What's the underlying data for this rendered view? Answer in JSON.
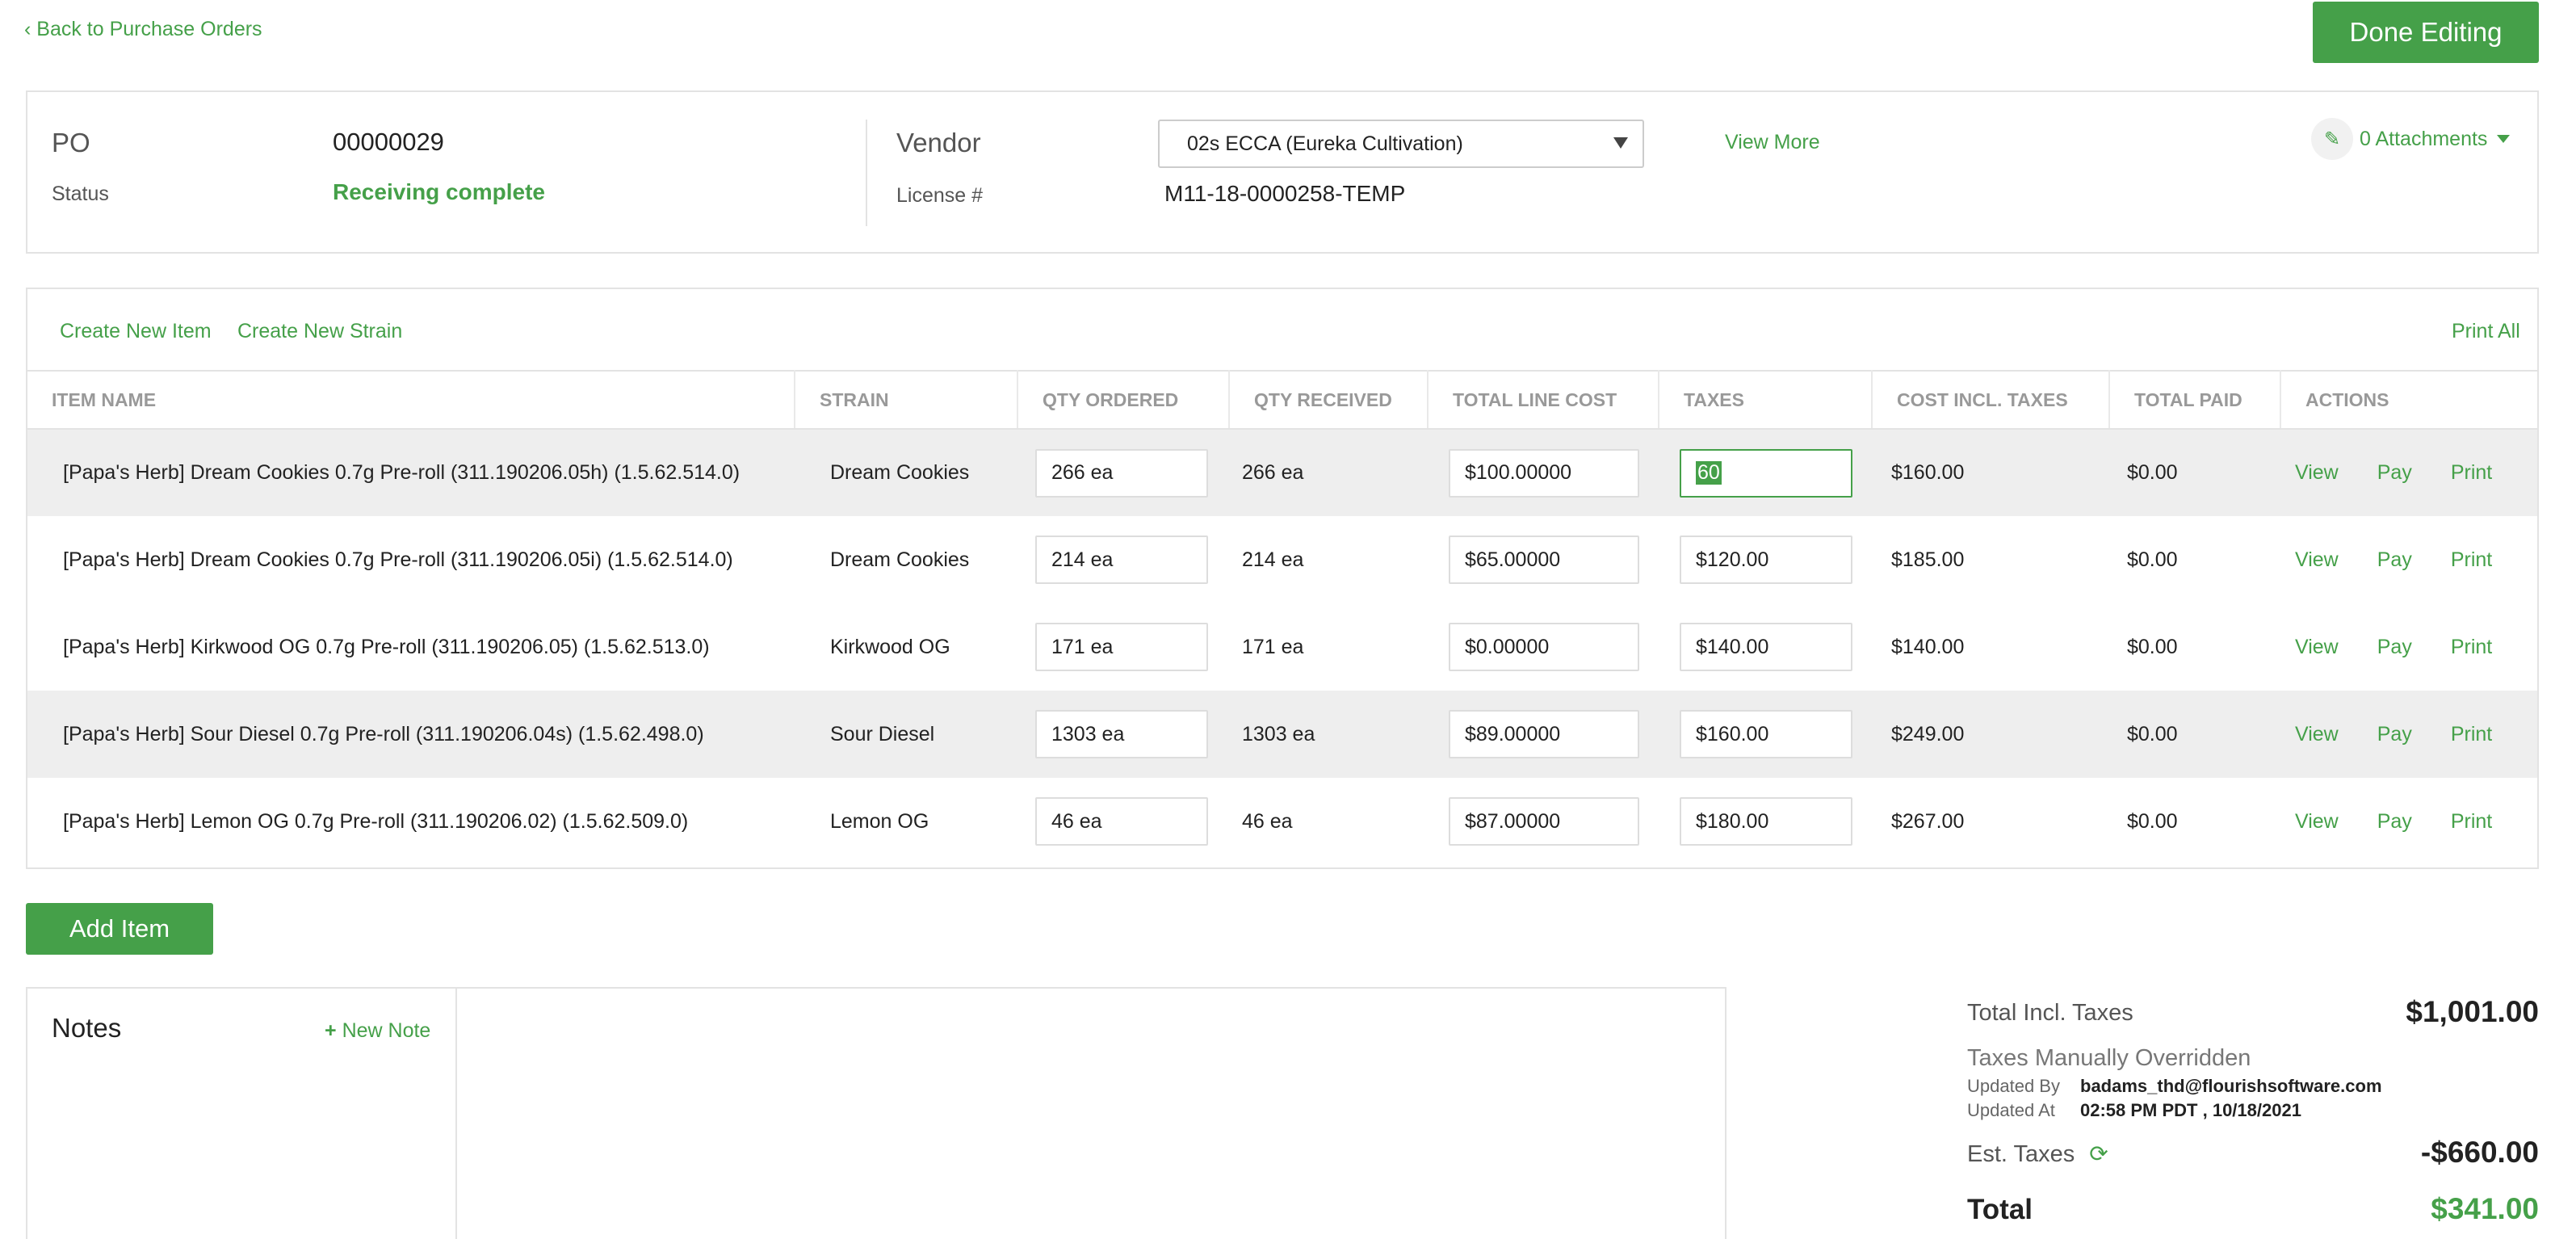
{
  "nav": {
    "back_label": "‹ Back to Purchase Orders",
    "done_label": "Done Editing"
  },
  "po": {
    "po_label": "PO",
    "po_number": "00000029",
    "status_label": "Status",
    "status_value": "Receiving complete",
    "vendor_label": "Vendor",
    "vendor_value": "02s ECCA (Eureka Cultivation)",
    "license_label": "License #",
    "license_value": "M11-18-0000258-TEMP",
    "view_more": "View More",
    "attachments": "0 Attachments"
  },
  "toolbar": {
    "create_item": "Create New Item",
    "create_strain": "Create New Strain",
    "print_all": "Print All"
  },
  "table": {
    "headers": [
      "ITEM NAME",
      "STRAIN",
      "QTY ORDERED",
      "QTY RECEIVED",
      "TOTAL LINE COST",
      "TAXES",
      "COST INCL. TAXES",
      "TOTAL PAID",
      "ACTIONS"
    ],
    "rows": [
      {
        "item": "[Papa's Herb] Dream Cookies 0.7g Pre-roll (311.190206.05h) (1.5.62.514.0)",
        "strain": "Dream Cookies",
        "qty_ordered": "266 ea",
        "qty_received": "266 ea",
        "line_cost": "$100.00000",
        "taxes": "60",
        "cost_incl": "$160.00",
        "paid": "$0.00"
      },
      {
        "item": "[Papa's Herb] Dream Cookies 0.7g Pre-roll (311.190206.05i) (1.5.62.514.0)",
        "strain": "Dream Cookies",
        "qty_ordered": "214 ea",
        "qty_received": "214 ea",
        "line_cost": "$65.00000",
        "taxes": "$120.00",
        "cost_incl": "$185.00",
        "paid": "$0.00"
      },
      {
        "item": "[Papa's Herb] Kirkwood OG 0.7g Pre-roll (311.190206.05) (1.5.62.513.0)",
        "strain": "Kirkwood OG",
        "qty_ordered": "171 ea",
        "qty_received": "171 ea",
        "line_cost": "$0.00000",
        "taxes": "$140.00",
        "cost_incl": "$140.00",
        "paid": "$0.00"
      },
      {
        "item": "[Papa's Herb] Sour Diesel 0.7g Pre-roll (311.190206.04s) (1.5.62.498.0)",
        "strain": "Sour Diesel",
        "qty_ordered": "1303 ea",
        "qty_received": "1303 ea",
        "line_cost": "$89.00000",
        "taxes": "$160.00",
        "cost_incl": "$249.00",
        "paid": "$0.00"
      },
      {
        "item": "[Papa's Herb] Lemon OG 0.7g Pre-roll (311.190206.02) (1.5.62.509.0)",
        "strain": "Lemon OG",
        "qty_ordered": "46 ea",
        "qty_received": "46 ea",
        "line_cost": "$87.00000",
        "taxes": "$180.00",
        "cost_incl": "$267.00",
        "paid": "$0.00"
      }
    ],
    "actions": {
      "view": "View",
      "pay": "Pay",
      "print": "Print"
    }
  },
  "add_item_label": "Add Item",
  "notes": {
    "title": "Notes",
    "new_note": "New Note"
  },
  "totals": {
    "incl_taxes_label": "Total Incl. Taxes",
    "incl_taxes_value": "$1,001.00",
    "override_label": "Taxes Manually Overridden",
    "updated_by_label": "Updated By",
    "updated_by_value": "badams_thd@flourishsoftware.com",
    "updated_at_label": "Updated At",
    "updated_at_value": "02:58 PM PDT , 10/18/2021",
    "est_taxes_label": "Est. Taxes",
    "est_taxes_value": "-$660.00",
    "total_label": "Total",
    "total_value": "$341.00"
  },
  "colors": {
    "accent": "#45a049",
    "row_shade": "#eeeeee",
    "border": "#e3e3e3"
  },
  "icons": {
    "attachment": "paperclip-icon",
    "refresh": "refresh-icon",
    "new_note": "plus-icon"
  }
}
